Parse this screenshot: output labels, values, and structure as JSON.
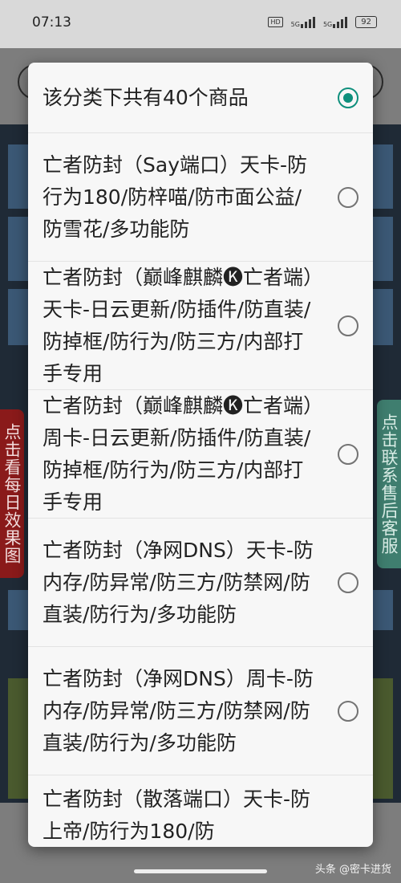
{
  "status_bar": {
    "time": "07:13",
    "hd_label": "HD",
    "net1": "5G",
    "net2": "5G",
    "battery": "92"
  },
  "side_tabs": {
    "left": "点击看每日效果图",
    "right": "点击联系售后客服"
  },
  "dialog": {
    "options": [
      {
        "label": "该分类下共有40个商品",
        "checked": true
      },
      {
        "label": "亡者防封（Say端口）天卡-防行为180/防梓喵/防市面公益/防雪花/多功能防",
        "checked": false
      },
      {
        "label": "亡者防封（巅峰麒麟🅚亡者端）天卡-日云更新/防插件/防直装/防掉框/防行为/防三方/内部打手专用",
        "checked": false
      },
      {
        "label": "亡者防封（巅峰麒麟🅚亡者端）周卡-日云更新/防插件/防直装/防掉框/防行为/防三方/内部打手专用",
        "checked": false
      },
      {
        "label": "亡者防封（净网DNS）天卡-防内存/防异常/防三方/防禁网/防直装/防行为/多功能防",
        "checked": false
      },
      {
        "label": "亡者防封（净网DNS）周卡-防内存/防异常/防三方/防禁网/防直装/防行为/多功能防",
        "checked": false
      },
      {
        "label": "亡者防封（散落端口）天卡-防上帝/防行为180/防",
        "checked": false
      }
    ]
  },
  "watermark": "头条 @密卡进货",
  "colors": {
    "accent": "#0e8f7c",
    "radio_border": "#737373"
  }
}
